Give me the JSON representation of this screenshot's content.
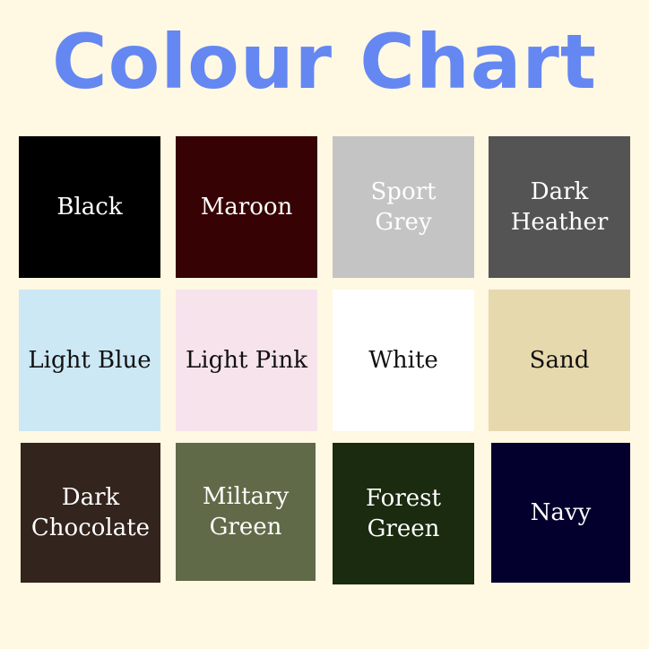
{
  "title": "Colour Chart",
  "colors": {
    "title": "#6487f2",
    "background": "#fff8e3"
  },
  "swatches": [
    {
      "label": "Black",
      "color": "#000000",
      "text_color": "#ffffff"
    },
    {
      "label": "Maroon",
      "color": "#360204",
      "text_color": "#ffffff"
    },
    {
      "label": "Sport\nGrey",
      "color": "#c4c4c4",
      "text_color": "#ffffff"
    },
    {
      "label": "Dark\nHeather",
      "color": "#545454",
      "text_color": "#ffffff"
    },
    {
      "label": "Light Blue",
      "color": "#cde8f5",
      "text_color": "#111111"
    },
    {
      "label": "Light Pink",
      "color": "#f7e3eb",
      "text_color": "#111111"
    },
    {
      "label": "White",
      "color": "#ffffff",
      "text_color": "#111111"
    },
    {
      "label": "Sand",
      "color": "#e7d9ae",
      "text_color": "#111111"
    },
    {
      "label": "Dark\nChocolate",
      "color": "#33241d",
      "text_color": "#ffffff"
    },
    {
      "label": "Miltary\nGreen",
      "color": "#606a48",
      "text_color": "#ffffff"
    },
    {
      "label": "Forest\nGreen",
      "color": "#1a2b0f",
      "text_color": "#ffffff"
    },
    {
      "label": "Navy",
      "color": "#03002d",
      "text_color": "#ffffff"
    }
  ]
}
